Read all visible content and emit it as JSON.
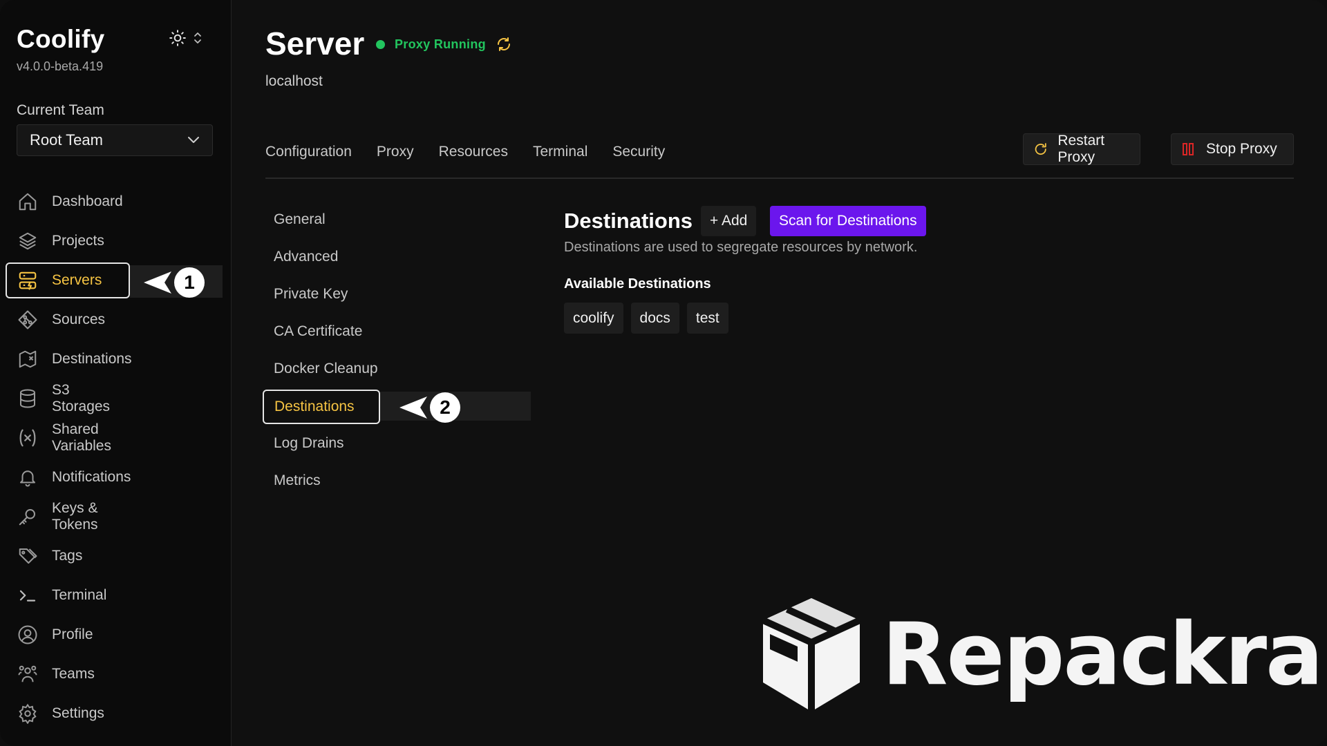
{
  "app": {
    "name": "Coolify",
    "version": "v4.0.0-beta.419"
  },
  "team": {
    "label": "Current Team",
    "selected": "Root Team"
  },
  "sidebar": {
    "items": [
      {
        "label": "Dashboard",
        "icon": "home-icon"
      },
      {
        "label": "Projects",
        "icon": "layers-icon"
      },
      {
        "label": "Servers",
        "icon": "server-icon",
        "active": true
      },
      {
        "label": "Sources",
        "icon": "git-icon"
      },
      {
        "label": "Destinations",
        "icon": "map-icon"
      },
      {
        "label": "S3 Storages",
        "icon": "database-icon"
      },
      {
        "label": "Shared Variables",
        "icon": "variable-icon"
      },
      {
        "label": "Notifications",
        "icon": "bell-icon"
      },
      {
        "label": "Keys & Tokens",
        "icon": "key-icon"
      },
      {
        "label": "Tags",
        "icon": "tags-icon"
      },
      {
        "label": "Terminal",
        "icon": "terminal-icon"
      },
      {
        "label": "Profile",
        "icon": "user-circle-icon"
      },
      {
        "label": "Teams",
        "icon": "users-icon"
      },
      {
        "label": "Settings",
        "icon": "gear-icon"
      }
    ]
  },
  "annotations": {
    "step1": "1",
    "step2": "2"
  },
  "server": {
    "title": "Server",
    "proxy_status": "Proxy Running",
    "host": "localhost",
    "tabs": [
      "Configuration",
      "Proxy",
      "Resources",
      "Terminal",
      "Security"
    ],
    "restart_label": "Restart Proxy",
    "stop_label": "Stop Proxy"
  },
  "subnav": {
    "items": [
      "General",
      "Advanced",
      "Private Key",
      "CA Certificate",
      "Docker Cleanup",
      "Destinations",
      "Log Drains",
      "Metrics"
    ],
    "active": "Destinations"
  },
  "destinations": {
    "title": "Destinations",
    "add_label": "+ Add",
    "scan_label": "Scan for Destinations",
    "description": "Destinations are used to segregate resources by network.",
    "available_title": "Available Destinations",
    "items": [
      "coolify",
      "docs",
      "test"
    ]
  },
  "watermark": {
    "text": "Repackra"
  },
  "colors": {
    "accent": "#f6c443",
    "primary": "#6b16ed",
    "success": "#22c55e",
    "danger": "#dc2626"
  }
}
